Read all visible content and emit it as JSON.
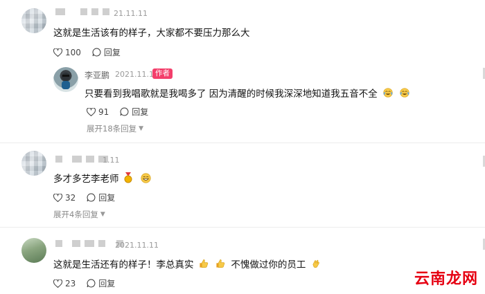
{
  "comments": [
    {
      "date": "21.11.11",
      "text": "这就是生活该有的样子，大家都不要压力那么大",
      "likes": "100",
      "reply_label": "回复",
      "reply": {
        "author": "李亚鹏",
        "date": "2021.11.11",
        "badge": "作者",
        "text": "只要看到我唱歌就是我喝多了 因为清醒的时候我深深地知道我五音不全",
        "likes": "91",
        "reply_label": "回复",
        "expand": "展开18条回复"
      }
    },
    {
      "date": "1.11",
      "text": "多才多艺李老师",
      "likes": "32",
      "reply_label": "回复",
      "expand": "展开4条回复"
    },
    {
      "date": "2021.11.11",
      "text_a": "这就是生活还有的样子！李总真实",
      "text_b": "不愧做过你的员工",
      "likes": "23",
      "reply_label": "回复"
    }
  ],
  "watermark": "云南龙网",
  "colors": {
    "badge": "#f33f6b",
    "watermark": "#e60012"
  }
}
